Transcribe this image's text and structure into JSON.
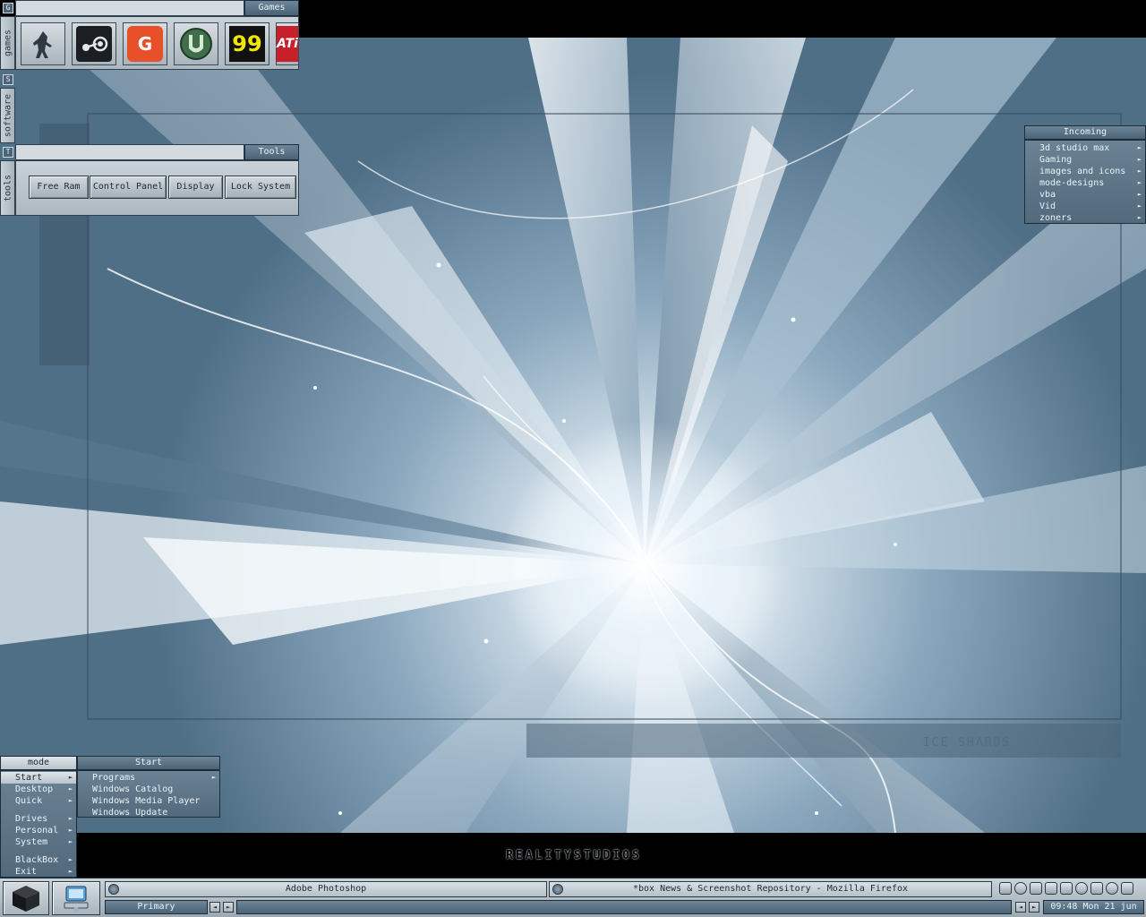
{
  "games_panel": {
    "title": "Games",
    "tab_letter": "G",
    "tab_label": "games",
    "icons": [
      {
        "name": "counter-strike-icon",
        "color": "#8a9aa6"
      },
      {
        "name": "steam-icon",
        "color": "#1b1f24"
      },
      {
        "name": "game-spy-icon",
        "color": "#e8502a"
      },
      {
        "name": "unreal-tournament-icon",
        "color": "#3f6e4a"
      },
      {
        "name": "game-99-icon",
        "color": "#f2e600",
        "text": "99"
      },
      {
        "name": "ati-icon",
        "color": "#c8202a",
        "text": "ATi"
      }
    ]
  },
  "software_panel": {
    "tab_letter": "S",
    "tab_label": "software"
  },
  "tools_panel": {
    "title": "Tools",
    "tab_letter": "T",
    "tab_label": "tools",
    "buttons": [
      "Free Ram",
      "Control Panel",
      "Display",
      "Lock System"
    ]
  },
  "incoming_menu": {
    "title": "Incoming",
    "items": [
      "3d studio max",
      "Gaming",
      "images and icons",
      "mode-designs",
      "vba",
      "Vid",
      "zoners"
    ]
  },
  "mode_menu": {
    "title": "mode",
    "items": [
      "Start",
      "Desktop",
      "Quick",
      "Drives",
      "Personal",
      "System",
      "BlackBox",
      "Exit"
    ],
    "selected": "Start"
  },
  "start_submenu": {
    "title": "Start",
    "items": [
      "Programs",
      "Windows Catalog",
      "Windows Media Player",
      "Windows Update"
    ]
  },
  "wallpaper": {
    "deco_label": "REALITYSTUDIOS",
    "ice_label": "ICE SHARDS"
  },
  "taskbar": {
    "tasks": [
      "Adobe Photoshop",
      "*box News & Screenshot Repository - Mozilla Firefox"
    ],
    "workspace": "Primary",
    "clock": "09:48 Mon 21 jun"
  },
  "colors": {
    "accent": "#4b6376",
    "panel": "#b8c3cb",
    "wallpaper_base": "#6f8ea6"
  }
}
